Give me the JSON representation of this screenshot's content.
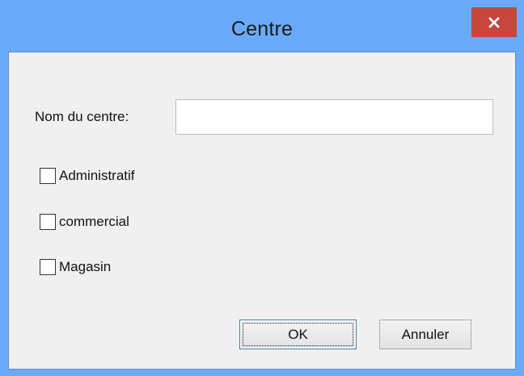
{
  "window": {
    "title": "Centre"
  },
  "form": {
    "name_label": "Nom du centre:",
    "name_value": "",
    "checkboxes": [
      {
        "label": "Administratif",
        "checked": false
      },
      {
        "label": "commercial",
        "checked": false
      },
      {
        "label": "Magasin",
        "checked": false
      }
    ]
  },
  "buttons": {
    "ok_label": "OK",
    "cancel_label": "Annuler"
  },
  "colors": {
    "titlebar": "#6aabf9",
    "close_button": "#c7473d",
    "client_background": "#f0f0f0"
  },
  "icons": {
    "close": "close-icon"
  }
}
